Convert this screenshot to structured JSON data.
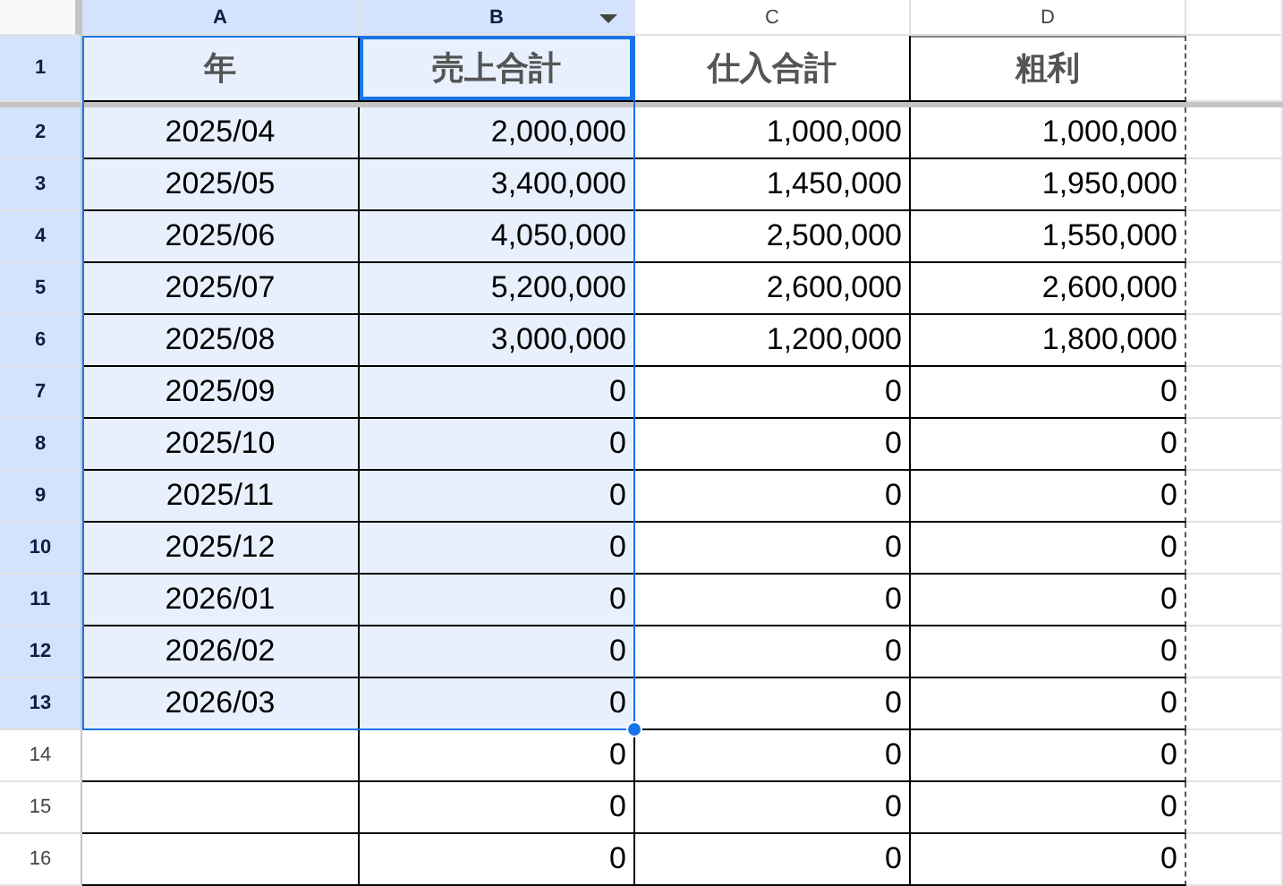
{
  "columns": [
    {
      "label": "A",
      "selected": true,
      "active": false,
      "menu": false,
      "copied": false
    },
    {
      "label": "B",
      "selected": true,
      "active": true,
      "menu": true,
      "copied": false
    },
    {
      "label": "C",
      "selected": false,
      "active": false,
      "menu": false,
      "copied": false
    },
    {
      "label": "D",
      "selected": false,
      "active": false,
      "menu": false,
      "copied": true
    }
  ],
  "header_row": {
    "number": "1",
    "selected": true,
    "cells": [
      "年",
      "売上合計",
      "仕入合計",
      "粗利"
    ]
  },
  "rows": [
    {
      "number": "2",
      "selected": true,
      "cells": [
        "2025/04",
        "2,000,000",
        "1,000,000",
        "1,000,000"
      ]
    },
    {
      "number": "3",
      "selected": true,
      "cells": [
        "2025/05",
        "3,400,000",
        "1,450,000",
        "1,950,000"
      ]
    },
    {
      "number": "4",
      "selected": true,
      "cells": [
        "2025/06",
        "4,050,000",
        "2,500,000",
        "1,550,000"
      ]
    },
    {
      "number": "5",
      "selected": true,
      "cells": [
        "2025/07",
        "5,200,000",
        "2,600,000",
        "2,600,000"
      ]
    },
    {
      "number": "6",
      "selected": true,
      "cells": [
        "2025/08",
        "3,000,000",
        "1,200,000",
        "1,800,000"
      ]
    },
    {
      "number": "7",
      "selected": true,
      "cells": [
        "2025/09",
        "0",
        "0",
        "0"
      ]
    },
    {
      "number": "8",
      "selected": true,
      "cells": [
        "2025/10",
        "0",
        "0",
        "0"
      ]
    },
    {
      "number": "9",
      "selected": true,
      "cells": [
        "2025/11",
        "0",
        "0",
        "0"
      ]
    },
    {
      "number": "10",
      "selected": true,
      "cells": [
        "2025/12",
        "0",
        "0",
        "0"
      ]
    },
    {
      "number": "11",
      "selected": true,
      "cells": [
        "2026/01",
        "0",
        "0",
        "0"
      ]
    },
    {
      "number": "12",
      "selected": true,
      "cells": [
        "2026/02",
        "0",
        "0",
        "0"
      ]
    },
    {
      "number": "13",
      "selected": true,
      "cells": [
        "2026/03",
        "0",
        "0",
        "0"
      ]
    },
    {
      "number": "14",
      "selected": false,
      "cells": [
        null,
        "0",
        "0",
        "0"
      ]
    },
    {
      "number": "15",
      "selected": false,
      "cells": [
        null,
        "0",
        "0",
        "0"
      ]
    },
    {
      "number": "16",
      "selected": false,
      "cells": [
        null,
        "0",
        "0",
        "0"
      ]
    }
  ]
}
